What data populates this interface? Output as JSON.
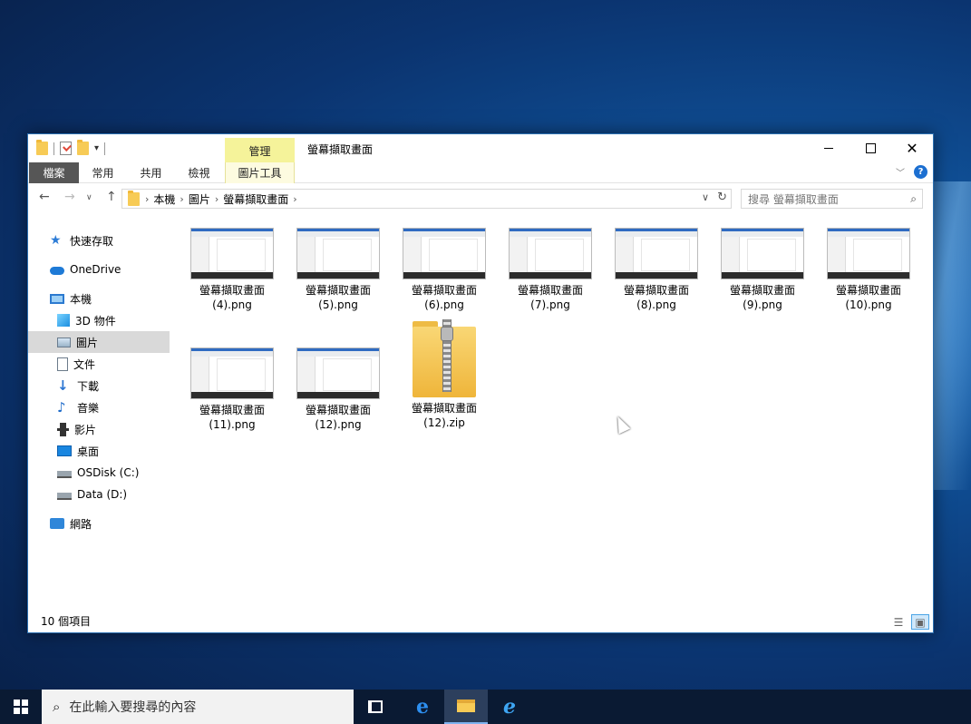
{
  "window": {
    "title": "螢幕擷取畫面",
    "context_tab_label": "管理"
  },
  "ribbon": {
    "tabs": [
      "檔案",
      "常用",
      "共用",
      "檢視"
    ],
    "context_tab": "圖片工具"
  },
  "address": {
    "crumbs": [
      "本機",
      "圖片",
      "螢幕擷取畫面"
    ],
    "search_placeholder": "搜尋 螢幕擷取畫面"
  },
  "sidebar": {
    "items": [
      {
        "label": "快速存取",
        "icon": "star-icon"
      },
      {
        "label": "OneDrive",
        "icon": "cloud-icon"
      },
      {
        "label": "本機",
        "icon": "computer-icon"
      },
      {
        "label": "3D 物件",
        "icon": "cube-icon"
      },
      {
        "label": "圖片",
        "icon": "pictures-icon"
      },
      {
        "label": "文件",
        "icon": "document-icon"
      },
      {
        "label": "下載",
        "icon": "download-icon"
      },
      {
        "label": "音樂",
        "icon": "music-icon"
      },
      {
        "label": "影片",
        "icon": "film-icon"
      },
      {
        "label": "桌面",
        "icon": "desktop-icon"
      },
      {
        "label": "OSDisk (C:)",
        "icon": "disk-icon"
      },
      {
        "label": "Data (D:)",
        "icon": "disk-icon"
      },
      {
        "label": "網路",
        "icon": "network-icon"
      }
    ]
  },
  "files": [
    {
      "line1": "螢幕擷取畫面",
      "line2": "(4).png",
      "type": "png"
    },
    {
      "line1": "螢幕擷取畫面",
      "line2": "(5).png",
      "type": "png"
    },
    {
      "line1": "螢幕擷取畫面",
      "line2": "(6).png",
      "type": "png"
    },
    {
      "line1": "螢幕擷取畫面",
      "line2": "(7).png",
      "type": "png"
    },
    {
      "line1": "螢幕擷取畫面",
      "line2": "(8).png",
      "type": "png"
    },
    {
      "line1": "螢幕擷取畫面",
      "line2": "(9).png",
      "type": "png"
    },
    {
      "line1": "螢幕擷取畫面",
      "line2": "(10).png",
      "type": "png"
    },
    {
      "line1": "螢幕擷取畫面",
      "line2": "(11).png",
      "type": "png"
    },
    {
      "line1": "螢幕擷取畫面",
      "line2": "(12).png",
      "type": "png"
    },
    {
      "line1": "螢幕擷取畫面",
      "line2": "(12).zip",
      "type": "zip"
    }
  ],
  "status": {
    "item_count": "10 個項目"
  },
  "taskbar": {
    "search_placeholder": "在此輸入要搜尋的內容"
  },
  "colors": {
    "accent": "#1c6fd1",
    "context_tab": "#f5f39a",
    "file_tab": "#565656"
  }
}
